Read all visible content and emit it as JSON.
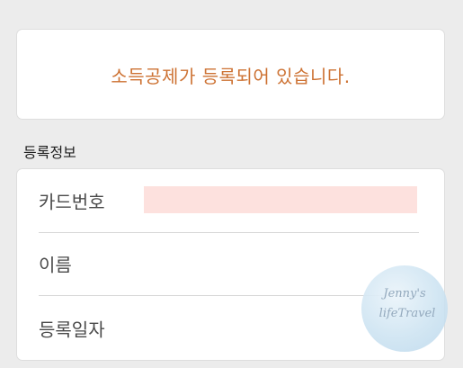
{
  "notice": {
    "message": "소득공제가 등록되어 있습니다."
  },
  "section": {
    "title": "등록정보"
  },
  "fields": [
    {
      "label": "카드번호",
      "value": ""
    },
    {
      "label": "이름",
      "value": ""
    },
    {
      "label": "등록일자",
      "value": ""
    }
  ],
  "watermark": {
    "line1": "Jenny's",
    "line2": "lifeTravel"
  },
  "colors": {
    "notice_text": "#cd7233",
    "redaction": "#fde1de",
    "background": "#ececec"
  }
}
